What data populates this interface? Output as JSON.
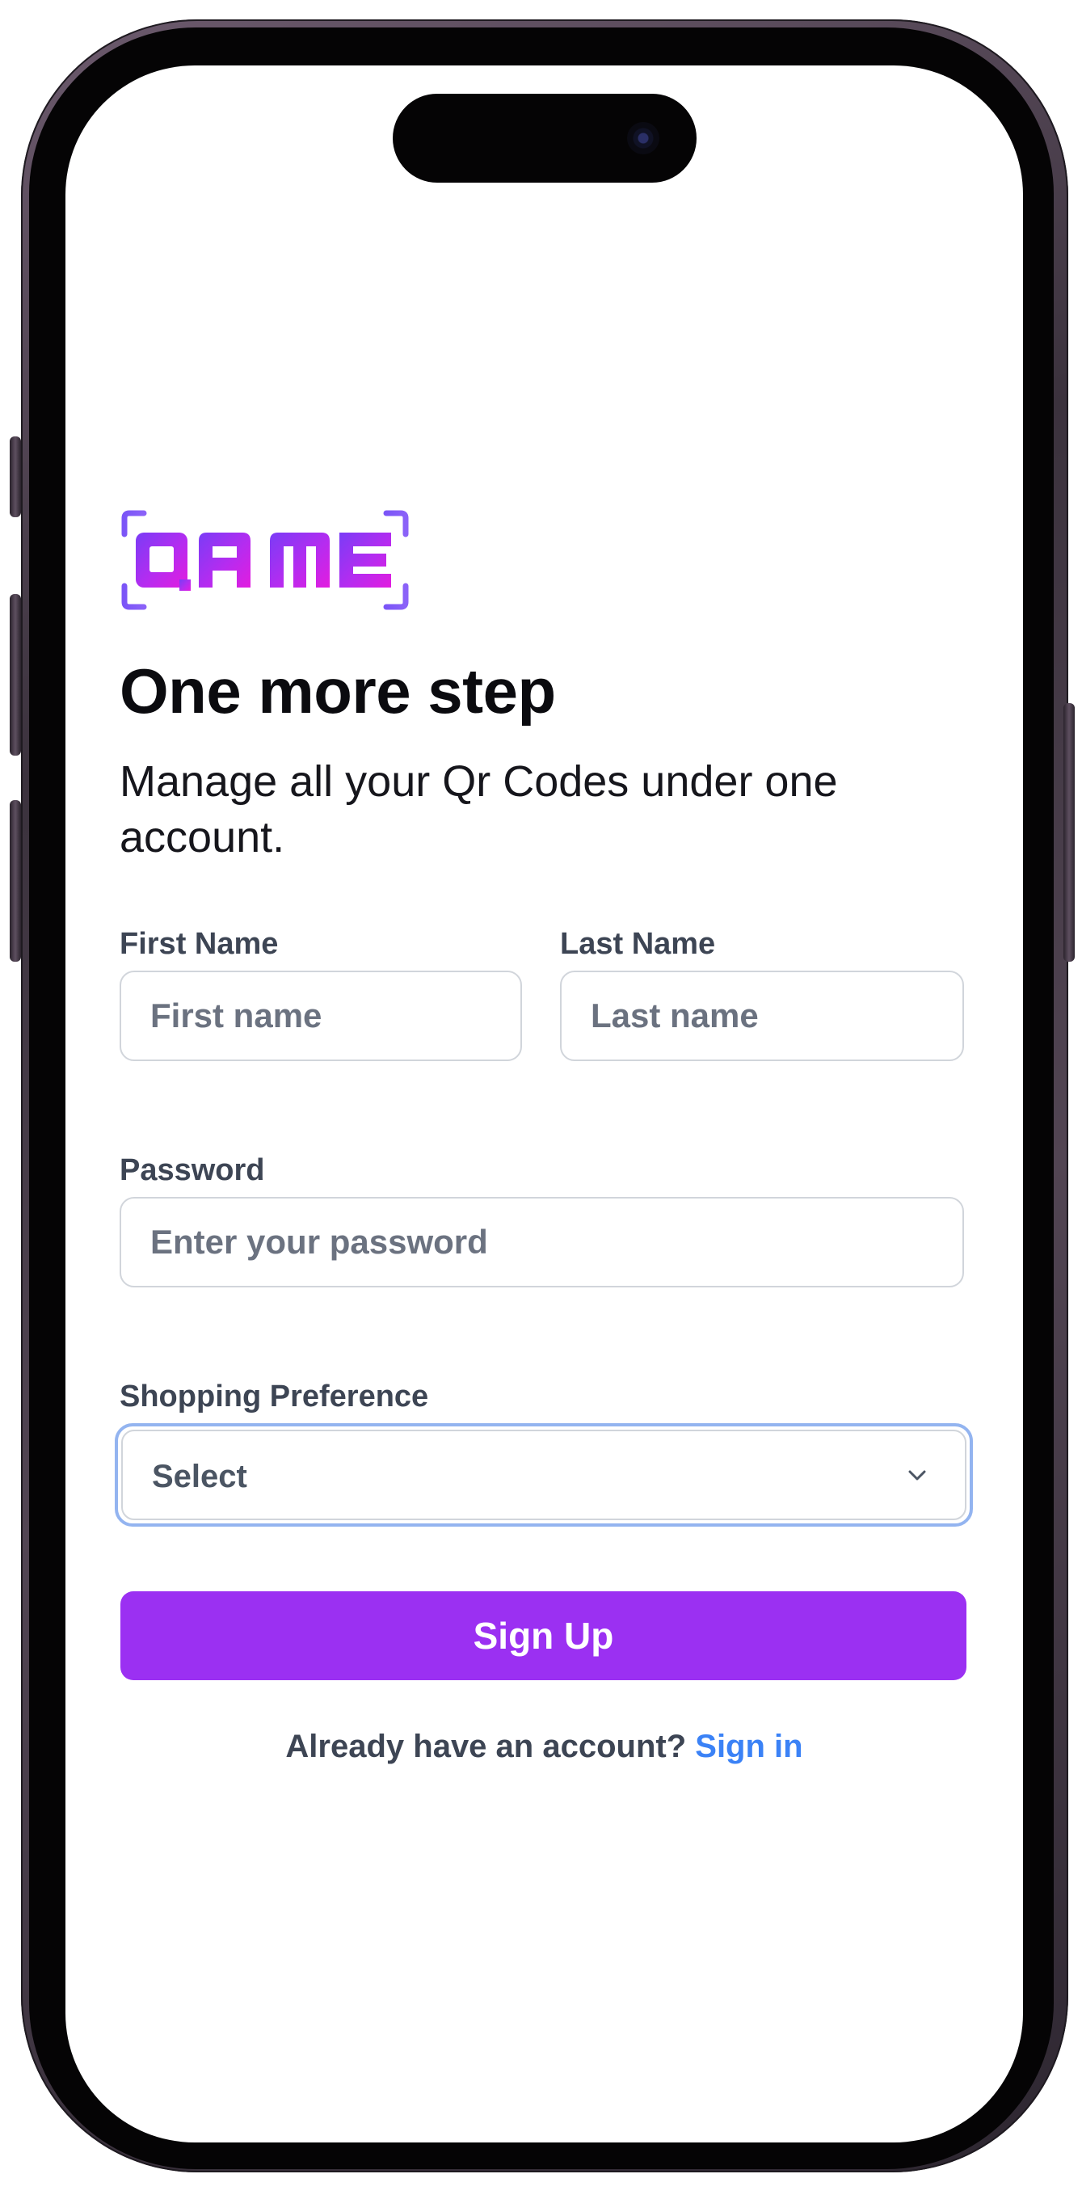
{
  "app": {
    "logo_text": "QR ME",
    "brand_color": "#9b30f2",
    "brand_gradient": [
      "#6a3df5",
      "#d11fe8"
    ]
  },
  "form": {
    "heading": "One more step",
    "subtitle": "Manage all your Qr Codes under one account.",
    "first_name": {
      "label": "First Name",
      "placeholder": "First name",
      "value": ""
    },
    "last_name": {
      "label": "Last Name",
      "placeholder": "Last name",
      "value": ""
    },
    "password": {
      "label": "Password",
      "placeholder": "Enter your password",
      "value": ""
    },
    "shopping_preference": {
      "label": "Shopping Preference",
      "selected": "Select",
      "focused": true
    },
    "submit_label": "Sign Up",
    "footer_text": "Already have an account?",
    "signin_link": "Sign in"
  },
  "colors": {
    "label": "#3d4554",
    "placeholder": "#6b7280",
    "link": "#3b82f6",
    "focus_ring": "#93b4f0"
  }
}
